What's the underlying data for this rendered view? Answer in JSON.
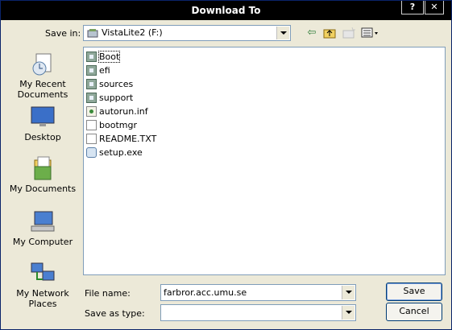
{
  "window": {
    "title": "Download To",
    "help_label": "?",
    "close_label": "✕"
  },
  "location": {
    "label": "Save in:",
    "value": "VistaLite2 (F:)"
  },
  "toolbar": {
    "back_icon": "back-arrow-icon",
    "up_icon": "up-folder-icon",
    "new_folder_icon": "new-folder-icon",
    "views_icon": "views-menu-icon"
  },
  "places": [
    {
      "name": "recent",
      "label": "My Recent Documents",
      "icon": "recent-documents-icon"
    },
    {
      "name": "desktop",
      "label": "Desktop",
      "icon": "desktop-icon"
    },
    {
      "name": "documents",
      "label": "My Documents",
      "icon": "my-documents-icon"
    },
    {
      "name": "computer",
      "label": "My Computer",
      "icon": "my-computer-icon"
    },
    {
      "name": "network",
      "label": "My Network Places",
      "icon": "network-places-icon"
    }
  ],
  "files": [
    {
      "name": "Boot",
      "type": "folder",
      "selected": true
    },
    {
      "name": "efi",
      "type": "folder"
    },
    {
      "name": "sources",
      "type": "folder"
    },
    {
      "name": "support",
      "type": "folder"
    },
    {
      "name": "autorun.inf",
      "type": "inf"
    },
    {
      "name": "bootmgr",
      "type": "doc"
    },
    {
      "name": "README.TXT",
      "type": "doc"
    },
    {
      "name": "setup.exe",
      "type": "exe"
    }
  ],
  "form": {
    "file_name_label": "File name:",
    "file_name_value": "farbror.acc.umu.se",
    "save_type_label": "Save as type:",
    "save_type_value": ""
  },
  "buttons": {
    "save": "Save",
    "cancel": "Cancel"
  }
}
